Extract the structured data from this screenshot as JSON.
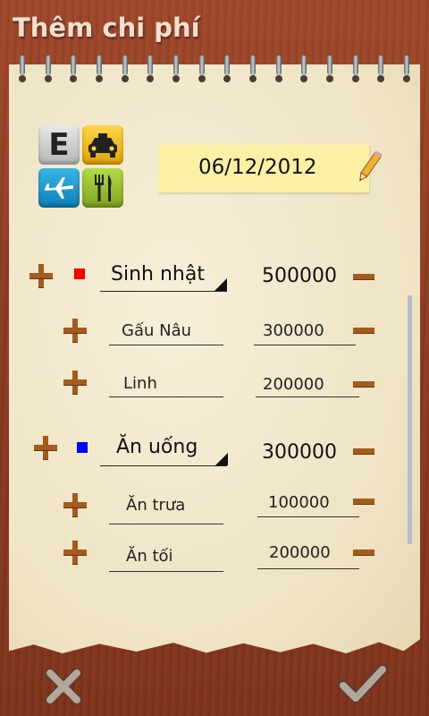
{
  "header": {
    "title": "Thêm chi phí"
  },
  "date": "06/12/2012",
  "category_icon": "expense-category-icon",
  "groups": [
    {
      "name": "Sinh nhật",
      "amount": "500000",
      "color": "#ff0000",
      "items": [
        {
          "name": "Gấu Nâu",
          "amount": "300000"
        },
        {
          "name": "Linh",
          "amount": "200000"
        }
      ]
    },
    {
      "name": "Ăn uống",
      "amount": "300000",
      "color": "#0000ff",
      "items": [
        {
          "name": "Ăn trưa",
          "amount": "100000"
        },
        {
          "name": "Ăn tối",
          "amount": "200000"
        }
      ]
    }
  ],
  "footer": {
    "cancel_icon": "close-icon",
    "confirm_icon": "checkmark-icon"
  }
}
